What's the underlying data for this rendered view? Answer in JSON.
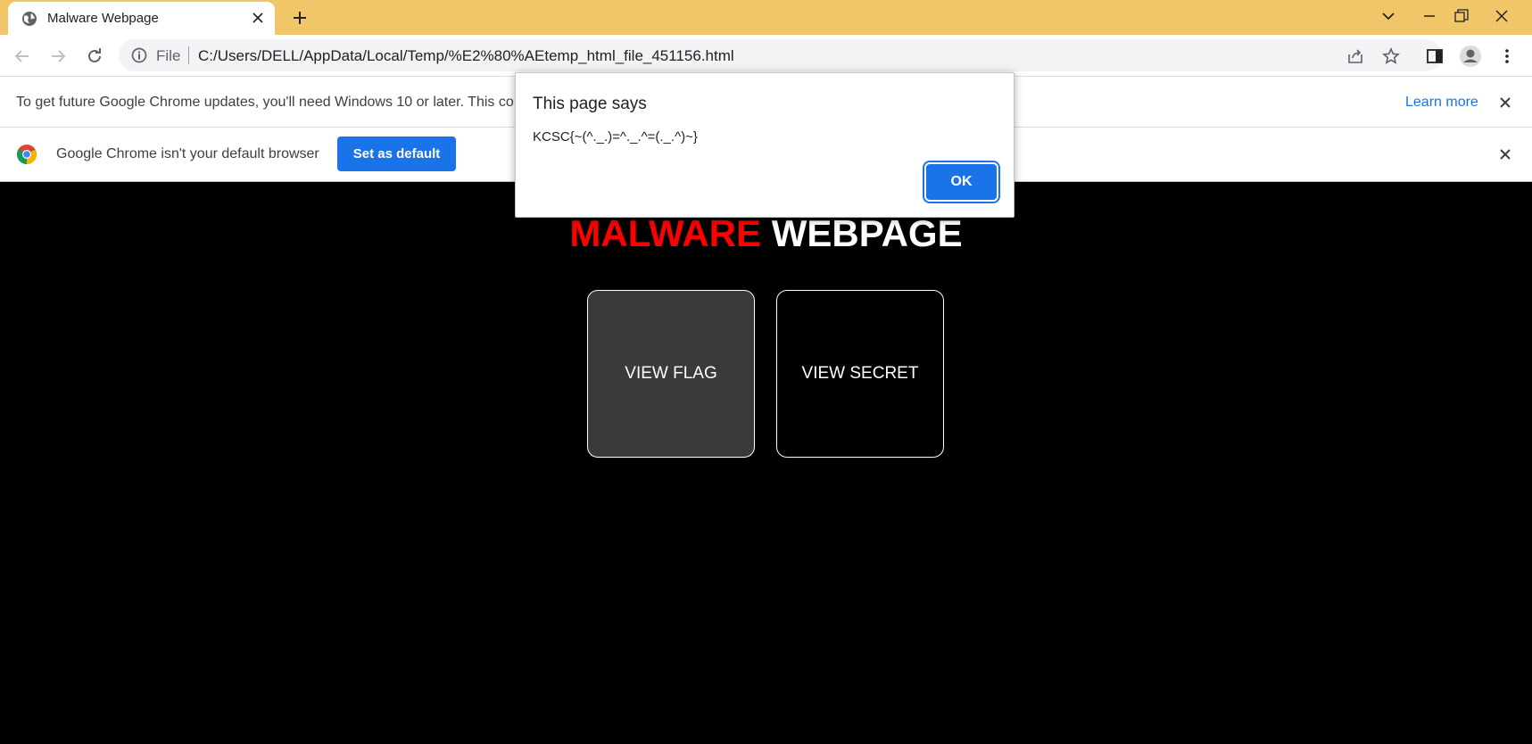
{
  "browser": {
    "tab": {
      "title": "Malware Webpage"
    },
    "address": {
      "scheme_label": "File",
      "url": "C:/Users/DELL/AppData/Local/Temp/%E2%80%AEtemp_html_file_451156.html"
    }
  },
  "infobars": {
    "update": {
      "text": "To get future Google Chrome updates, you'll need Windows 10 or later. This co",
      "link": "Learn more"
    },
    "default_browser": {
      "text": "Google Chrome isn't your default browser",
      "button": "Set as default"
    }
  },
  "page": {
    "title_red": "MALWARE",
    "title_white": "WEBPAGE",
    "buttons": {
      "flag": "VIEW FLAG",
      "secret": "VIEW SECRET"
    }
  },
  "dialog": {
    "title": "This page says",
    "message": "KCSC{~(^._.)=^._.^=(._.^)~}",
    "ok": "OK"
  },
  "colors": {
    "tabstrip": "#f0c669",
    "accent": "#1a73e8",
    "title_red": "#ff0000",
    "page_bg": "#000000"
  },
  "icons": [
    "globe-icon",
    "close-icon",
    "plus-icon",
    "chevron-down-icon",
    "minimize-icon",
    "restore-icon",
    "back-icon",
    "forward-icon",
    "reload-icon",
    "info-icon",
    "share-icon",
    "star-icon",
    "side-panel-icon",
    "profile-icon",
    "menu-icon",
    "chrome-logo-icon"
  ]
}
